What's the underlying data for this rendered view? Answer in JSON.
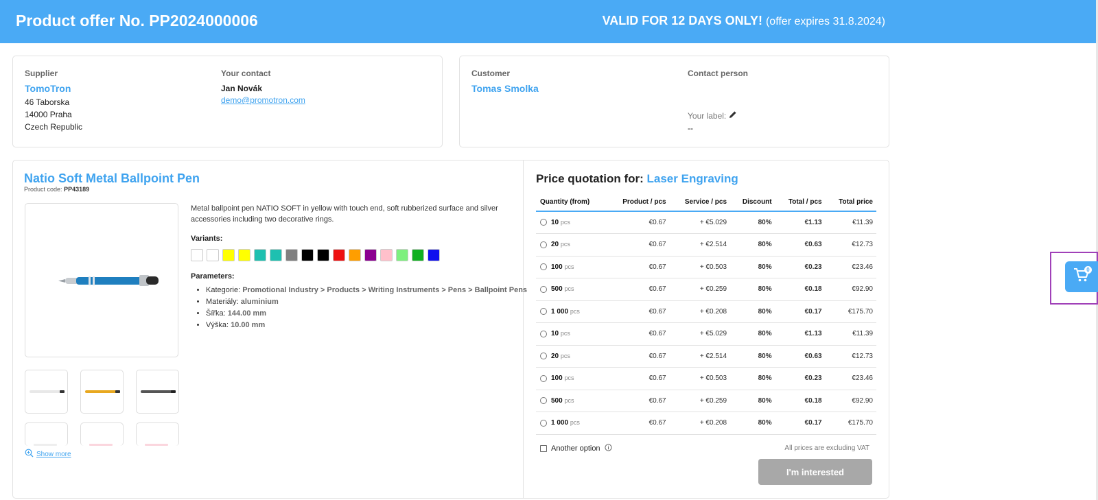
{
  "header": {
    "title": "Product offer No. PP2024000006",
    "valid_strong": "VALID FOR 12 DAYS ONLY!",
    "valid_expires": "(offer expires 31.8.2024)"
  },
  "supplier": {
    "label": "Supplier",
    "name": "TomoTron",
    "address1": "46 Taborska",
    "address2": "14000 Praha",
    "address3": "Czech Republic"
  },
  "your_contact": {
    "label": "Your contact",
    "name": "Jan Novák",
    "email": "demo@promotron.com"
  },
  "customer": {
    "label": "Customer",
    "name": "Tomas Smolka"
  },
  "contact_person": {
    "label": "Contact person",
    "your_label": "Your label:",
    "value": "--"
  },
  "product": {
    "title": "Natio Soft Metal Ballpoint Pen",
    "code_label": "Product code:",
    "code": "PP43189",
    "description": "Metal ballpoint pen NATIO SOFT in yellow with touch end, soft rubberized surface and silver accessories including two decorative rings.",
    "variants_label": "Variants:",
    "variants": [
      "#ffffff",
      "#ffffff",
      "#ffff00",
      "#ffff00",
      "#1ec0b0",
      "#1ec0b0",
      "#808080",
      "#000000",
      "#000000",
      "#ee1111",
      "#ff9e00",
      "#8b0090",
      "#ffc0cb",
      "#7ef07e",
      "#10b020",
      "#1010ee"
    ],
    "parameters_label": "Parameters:",
    "parameters": [
      {
        "key": "Kategorie:",
        "value": "Promotional Industry > Products > Writing Instruments > Pens > Ballpoint Pens"
      },
      {
        "key": "Materiály:",
        "value": "aluminium"
      },
      {
        "key": "Šířka:",
        "value": "144.00 mm"
      },
      {
        "key": "Výška:",
        "value": "10.00 mm"
      }
    ],
    "show_more": "Show more"
  },
  "quotation": {
    "title_prefix": "Price quotation for:",
    "service": "Laser Engraving",
    "columns": [
      "Quantity (from)",
      "Product / pcs",
      "Service / pcs",
      "Discount",
      "Total / pcs",
      "Total price"
    ],
    "unit": "pcs",
    "rows": [
      {
        "qty": "10",
        "product": "€0.67",
        "service": "+ €5.029",
        "discount": "80%",
        "total_pcs": "€1.13",
        "total": "€11.39"
      },
      {
        "qty": "20",
        "product": "€0.67",
        "service": "+ €2.514",
        "discount": "80%",
        "total_pcs": "€0.63",
        "total": "€12.73"
      },
      {
        "qty": "100",
        "product": "€0.67",
        "service": "+ €0.503",
        "discount": "80%",
        "total_pcs": "€0.23",
        "total": "€23.46"
      },
      {
        "qty": "500",
        "product": "€0.67",
        "service": "+ €0.259",
        "discount": "80%",
        "total_pcs": "€0.18",
        "total": "€92.90"
      },
      {
        "qty": "1 000",
        "product": "€0.67",
        "service": "+ €0.208",
        "discount": "80%",
        "total_pcs": "€0.17",
        "total": "€175.70"
      },
      {
        "qty": "10",
        "product": "€0.67",
        "service": "+ €5.029",
        "discount": "80%",
        "total_pcs": "€1.13",
        "total": "€11.39"
      },
      {
        "qty": "20",
        "product": "€0.67",
        "service": "+ €2.514",
        "discount": "80%",
        "total_pcs": "€0.63",
        "total": "€12.73"
      },
      {
        "qty": "100",
        "product": "€0.67",
        "service": "+ €0.503",
        "discount": "80%",
        "total_pcs": "€0.23",
        "total": "€23.46"
      },
      {
        "qty": "500",
        "product": "€0.67",
        "service": "+ €0.259",
        "discount": "80%",
        "total_pcs": "€0.18",
        "total": "€92.90"
      },
      {
        "qty": "1 000",
        "product": "€0.67",
        "service": "+ €0.208",
        "discount": "80%",
        "total_pcs": "€0.17",
        "total": "€175.70"
      }
    ],
    "another_option": "Another option",
    "vat_note": "All prices are excluding VAT",
    "cta": "I'm interested"
  },
  "cart": {
    "count": "0"
  },
  "colors": {
    "accent": "#4aaaf5",
    "discount": "#d02020",
    "cta_disabled": "#a8a8a8"
  }
}
